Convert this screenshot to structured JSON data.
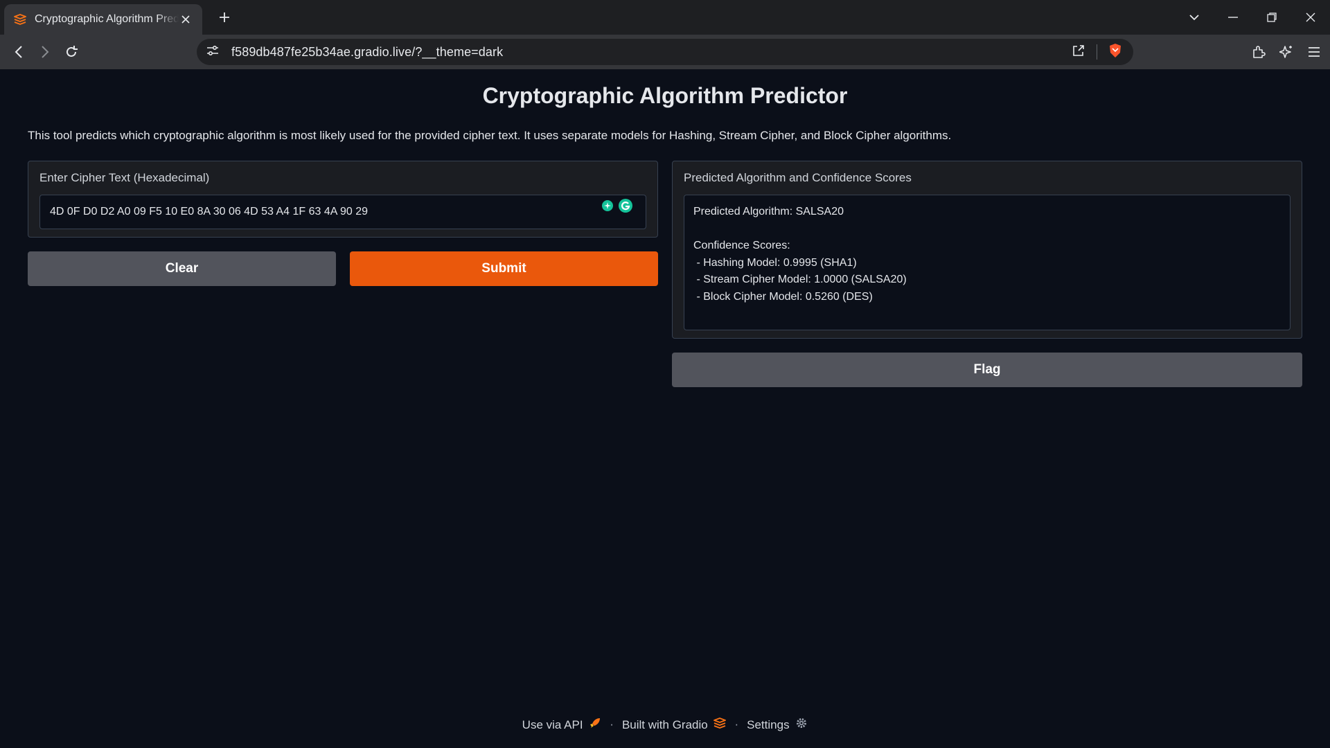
{
  "browser": {
    "tab_title": "Cryptographic Algorithm Predictor",
    "url": "f589db487fe25b34ae.gradio.live/?__theme=dark"
  },
  "app": {
    "title": "Cryptographic Algorithm Predictor",
    "description": "This tool predicts which cryptographic algorithm is most likely used for the provided cipher text. It uses separate models for Hashing, Stream Cipher, and Block Cipher algorithms.",
    "input": {
      "label": "Enter Cipher Text (Hexadecimal)",
      "value": "4D 0F D0 D2 A0 09 F5 10 E0 8A 30 06 4D 53 A4 1F 63 4A 90 29"
    },
    "output": {
      "label": "Predicted Algorithm and Confidence Scores",
      "text": "Predicted Algorithm: SALSA20\n\nConfidence Scores:\n - Hashing Model: 0.9995 (SHA1)\n - Stream Cipher Model: 1.0000 (SALSA20)\n - Block Cipher Model: 0.5260 (DES)"
    },
    "buttons": {
      "clear": "Clear",
      "submit": "Submit",
      "flag": "Flag"
    }
  },
  "footer": {
    "api": "Use via API",
    "built": "Built with Gradio",
    "settings": "Settings",
    "separator": "·"
  },
  "colors": {
    "accent": "#ea580c",
    "background": "#0b0f19",
    "secondary_button": "#52545c"
  },
  "icons": [
    "gradio-logo-icon",
    "close-icon",
    "plus-icon",
    "chevron-down-icon",
    "minimize-icon",
    "restore-icon",
    "back-icon",
    "forward-icon",
    "reload-icon",
    "site-settings-icon",
    "share-icon",
    "brave-shield-icon",
    "extensions-icon",
    "leo-ai-icon",
    "menu-icon",
    "rocket-icon",
    "gear-icon"
  ]
}
